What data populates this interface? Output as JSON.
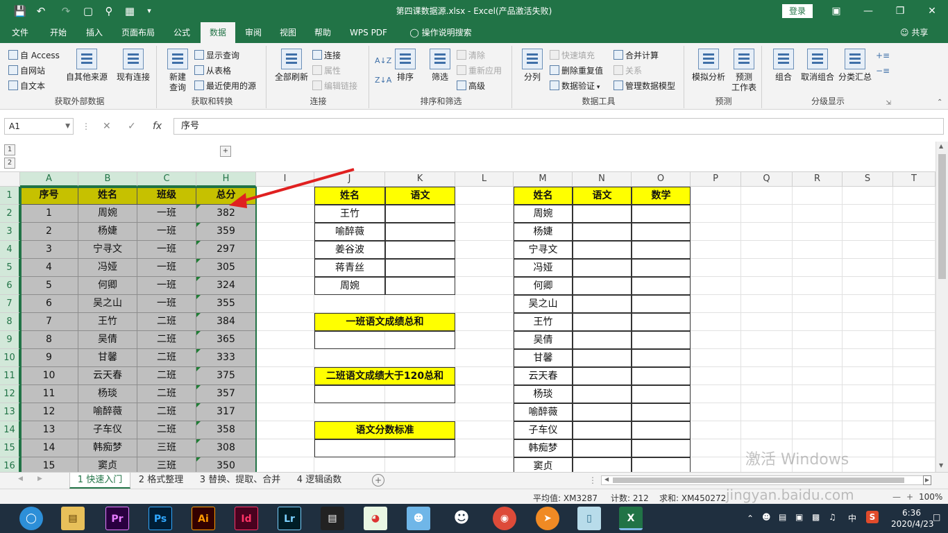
{
  "titlebar": {
    "title": "第四课数据源.xlsx  -  Excel(产品激活失败)",
    "login": "登录",
    "save_icon": "save-icon",
    "undo_icon": "undo-icon",
    "redo_icon": "redo-icon"
  },
  "tabs": [
    "文件",
    "开始",
    "插入",
    "页面布局",
    "公式",
    "数据",
    "审阅",
    "视图",
    "帮助",
    "WPS PDF",
    "操作说明搜索"
  ],
  "active_tab": "数据",
  "share": "共享",
  "ribbon": {
    "get_external": {
      "access": "自 Access",
      "web": "自网站",
      "text": "自文本",
      "other": "自其他来源",
      "existing": "现有连接",
      "label": "获取外部数据"
    },
    "transform": {
      "new_query": "新建\n查询",
      "show_queries": "显示查询",
      "from_table": "从表格",
      "recent": "最近使用的源",
      "label": "获取和转换"
    },
    "connections": {
      "refresh_all": "全部刷新",
      "connections": "连接",
      "properties": "属性",
      "edit_links": "编辑链接",
      "label": "连接"
    },
    "sort_filter": {
      "sort": "排序",
      "filter": "筛选",
      "clear": "清除",
      "reapply": "重新应用",
      "advanced": "高级",
      "label": "排序和筛选"
    },
    "data_tools": {
      "text_to_columns": "分列",
      "flash_fill": "快速填充",
      "remove_dup": "删除重复值",
      "validation": "数据验证",
      "consolidate": "合并计算",
      "relationships": "关系",
      "data_model": "管理数据模型",
      "label": "数据工具"
    },
    "forecast": {
      "what_if": "模拟分析",
      "forecast_sheet": "预测\n工作表",
      "label": "预测"
    },
    "outline": {
      "group": "组合",
      "ungroup": "取消组合",
      "subtotal": "分类汇总",
      "label": "分级显示"
    }
  },
  "formula_bar": {
    "namebox": "A1",
    "formula": "序号"
  },
  "columns": [
    "A",
    "B",
    "C",
    "H",
    "I",
    "J",
    "K",
    "L",
    "M",
    "N",
    "O",
    "P",
    "Q",
    "R",
    "S",
    "T"
  ],
  "rows": [
    "1",
    "2",
    "3",
    "4",
    "5",
    "6",
    "7",
    "8",
    "9",
    "10",
    "11",
    "12",
    "13",
    "14",
    "15",
    "16"
  ],
  "table_main": {
    "headers": [
      "序号",
      "姓名",
      "班级",
      "总分"
    ],
    "rows": [
      [
        "1",
        "周婉",
        "一班",
        "382"
      ],
      [
        "2",
        "杨婕",
        "一班",
        "359"
      ],
      [
        "3",
        "宁寻文",
        "一班",
        "297"
      ],
      [
        "4",
        "冯娅",
        "一班",
        "305"
      ],
      [
        "5",
        "何卿",
        "一班",
        "324"
      ],
      [
        "6",
        "吴之山",
        "一班",
        "355"
      ],
      [
        "7",
        "王竹",
        "二班",
        "384"
      ],
      [
        "8",
        "吴倩",
        "二班",
        "365"
      ],
      [
        "9",
        "甘馨",
        "二班",
        "333"
      ],
      [
        "10",
        "云天春",
        "二班",
        "375"
      ],
      [
        "11",
        "杨琰",
        "二班",
        "357"
      ],
      [
        "12",
        "喻醉薇",
        "二班",
        "317"
      ],
      [
        "13",
        "子车仪",
        "二班",
        "358"
      ],
      [
        "14",
        "韩痴梦",
        "三班",
        "308"
      ],
      [
        "15",
        "窦贞",
        "三班",
        "350"
      ]
    ]
  },
  "table_jk": {
    "headers": [
      "姓名",
      "语文"
    ],
    "names": [
      "王竹",
      "喻醉薇",
      "姜谷波",
      "蒋青丝",
      "周婉"
    ],
    "box1": "一班语文成绩总和",
    "box2": "二班语文成绩大于120总和",
    "box3": "语文分数标准"
  },
  "table_mno": {
    "headers": [
      "姓名",
      "语文",
      "数学"
    ],
    "names": [
      "周婉",
      "杨婕",
      "宁寻文",
      "冯娅",
      "何卿",
      "吴之山",
      "王竹",
      "吴倩",
      "甘馨",
      "云天春",
      "杨琰",
      "喻醉薇",
      "子车仪",
      "韩痴梦",
      "窦贞"
    ]
  },
  "sheets": [
    "1 快速入门",
    "2 格式整理",
    "3 替换、提取、合并",
    "4 逻辑函数"
  ],
  "active_sheet": "1 快速入门",
  "status": {
    "average": "平均值: XM3287",
    "count": "计数: 212",
    "sum": "求和: XM450272",
    "zoom": "100%"
  },
  "watermark": {
    "activate": "激活 Windows",
    "site": "jingyan.baidu.com"
  },
  "taskbar": {
    "apps": [
      "Pr",
      "Ps",
      "Ai",
      "Id",
      "Lr"
    ],
    "time": "6:36",
    "date": "2020/4/23",
    "ime": "中"
  },
  "colors": {
    "excel_green": "#217346",
    "header_olive": "#c6c100",
    "header_yellow": "#ffff00",
    "selection_gray": "#bfbfbf",
    "arrow_red": "#e02020"
  }
}
